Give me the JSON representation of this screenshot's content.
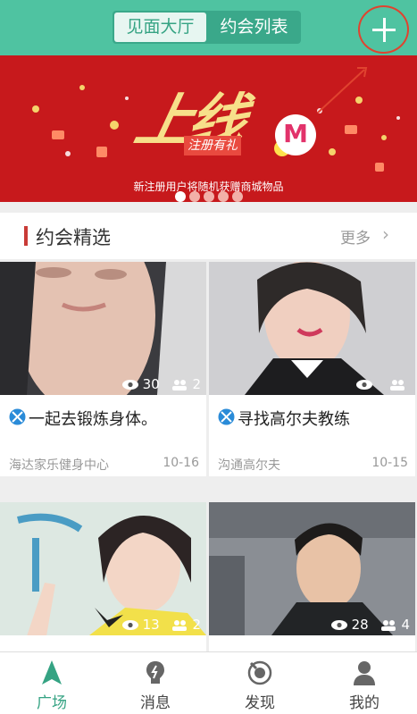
{
  "header": {
    "tab_active": "见面大厅",
    "tab_inactive": "约会列表"
  },
  "banner": {
    "headline": "上线",
    "tag": "注册有礼",
    "logo_letter": "M",
    "caption": "新注册用户将随机获赠商城物品",
    "slide_count": 5,
    "active_slide": 1
  },
  "section": {
    "title": "约会精选",
    "more": "更多",
    "chevron": "›"
  },
  "cards": [
    {
      "title": "一起去锻炼身体。",
      "place": "海达家乐健身中心",
      "date": "10-16",
      "views": "30",
      "people": "2"
    },
    {
      "title": "寻找高尔夫教练",
      "place": "沟通高尔夫",
      "date": "10-15",
      "views": "",
      "people": ""
    },
    {
      "title": "",
      "place": "",
      "date": "",
      "views": "13",
      "people": "2"
    },
    {
      "title": "",
      "place": "",
      "date": "",
      "views": "28",
      "people": "4"
    }
  ],
  "nav": [
    {
      "label": "广场",
      "icon": "plaza-icon",
      "active": true
    },
    {
      "label": "消息",
      "icon": "message-icon",
      "active": false
    },
    {
      "label": "发现",
      "icon": "discover-icon",
      "active": false
    },
    {
      "label": "我的",
      "icon": "profile-icon",
      "active": false
    }
  ],
  "colors": {
    "primary": "#4fc3a1",
    "banner_red": "#c7191c",
    "accent_red": "#c93b37",
    "highlight_ring": "#e0432f"
  }
}
